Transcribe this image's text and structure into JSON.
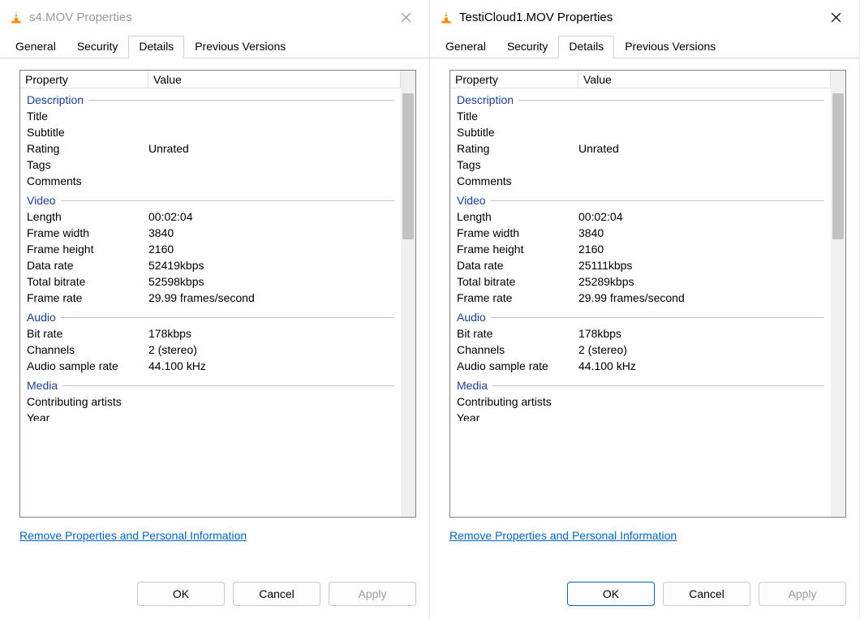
{
  "dialogs": [
    {
      "active": false,
      "title": "s4.MOV Properties",
      "tabs": [
        "General",
        "Security",
        "Details",
        "Previous Versions"
      ],
      "activeTab": "Details",
      "header": {
        "property": "Property",
        "value": "Value"
      },
      "sections": [
        {
          "title": "Description",
          "rows": [
            {
              "p": "Title",
              "v": ""
            },
            {
              "p": "Subtitle",
              "v": ""
            },
            {
              "p": "Rating",
              "v": "Unrated"
            },
            {
              "p": "Tags",
              "v": ""
            },
            {
              "p": "Comments",
              "v": ""
            }
          ]
        },
        {
          "title": "Video",
          "rows": [
            {
              "p": "Length",
              "v": "00:02:04"
            },
            {
              "p": "Frame width",
              "v": "3840"
            },
            {
              "p": "Frame height",
              "v": "2160"
            },
            {
              "p": "Data rate",
              "v": "52419kbps"
            },
            {
              "p": "Total bitrate",
              "v": "52598kbps"
            },
            {
              "p": "Frame rate",
              "v": "29.99 frames/second"
            }
          ]
        },
        {
          "title": "Audio",
          "rows": [
            {
              "p": "Bit rate",
              "v": "178kbps"
            },
            {
              "p": "Channels",
              "v": "2 (stereo)"
            },
            {
              "p": "Audio sample rate",
              "v": "44.100 kHz"
            }
          ]
        },
        {
          "title": "Media",
          "rows": [
            {
              "p": "Contributing artists",
              "v": ""
            }
          ],
          "cutoff": "Year"
        }
      ],
      "link": "Remove Properties and Personal Information",
      "buttons": {
        "ok": "OK",
        "cancel": "Cancel",
        "apply": "Apply"
      },
      "okDefault": false
    },
    {
      "active": true,
      "title": "TestiCloud1.MOV Properties",
      "tabs": [
        "General",
        "Security",
        "Details",
        "Previous Versions"
      ],
      "activeTab": "Details",
      "header": {
        "property": "Property",
        "value": "Value"
      },
      "sections": [
        {
          "title": "Description",
          "rows": [
            {
              "p": "Title",
              "v": ""
            },
            {
              "p": "Subtitle",
              "v": ""
            },
            {
              "p": "Rating",
              "v": "Unrated"
            },
            {
              "p": "Tags",
              "v": ""
            },
            {
              "p": "Comments",
              "v": ""
            }
          ]
        },
        {
          "title": "Video",
          "rows": [
            {
              "p": "Length",
              "v": "00:02:04"
            },
            {
              "p": "Frame width",
              "v": "3840"
            },
            {
              "p": "Frame height",
              "v": "2160"
            },
            {
              "p": "Data rate",
              "v": "25111kbps"
            },
            {
              "p": "Total bitrate",
              "v": "25289kbps"
            },
            {
              "p": "Frame rate",
              "v": "29.99 frames/second"
            }
          ]
        },
        {
          "title": "Audio",
          "rows": [
            {
              "p": "Bit rate",
              "v": "178kbps"
            },
            {
              "p": "Channels",
              "v": "2 (stereo)"
            },
            {
              "p": "Audio sample rate",
              "v": "44.100 kHz"
            }
          ]
        },
        {
          "title": "Media",
          "rows": [
            {
              "p": "Contributing artists",
              "v": ""
            }
          ],
          "cutoff": "Year"
        }
      ],
      "link": "Remove Properties and Personal Information",
      "buttons": {
        "ok": "OK",
        "cancel": "Cancel",
        "apply": "Apply"
      },
      "okDefault": true
    }
  ]
}
